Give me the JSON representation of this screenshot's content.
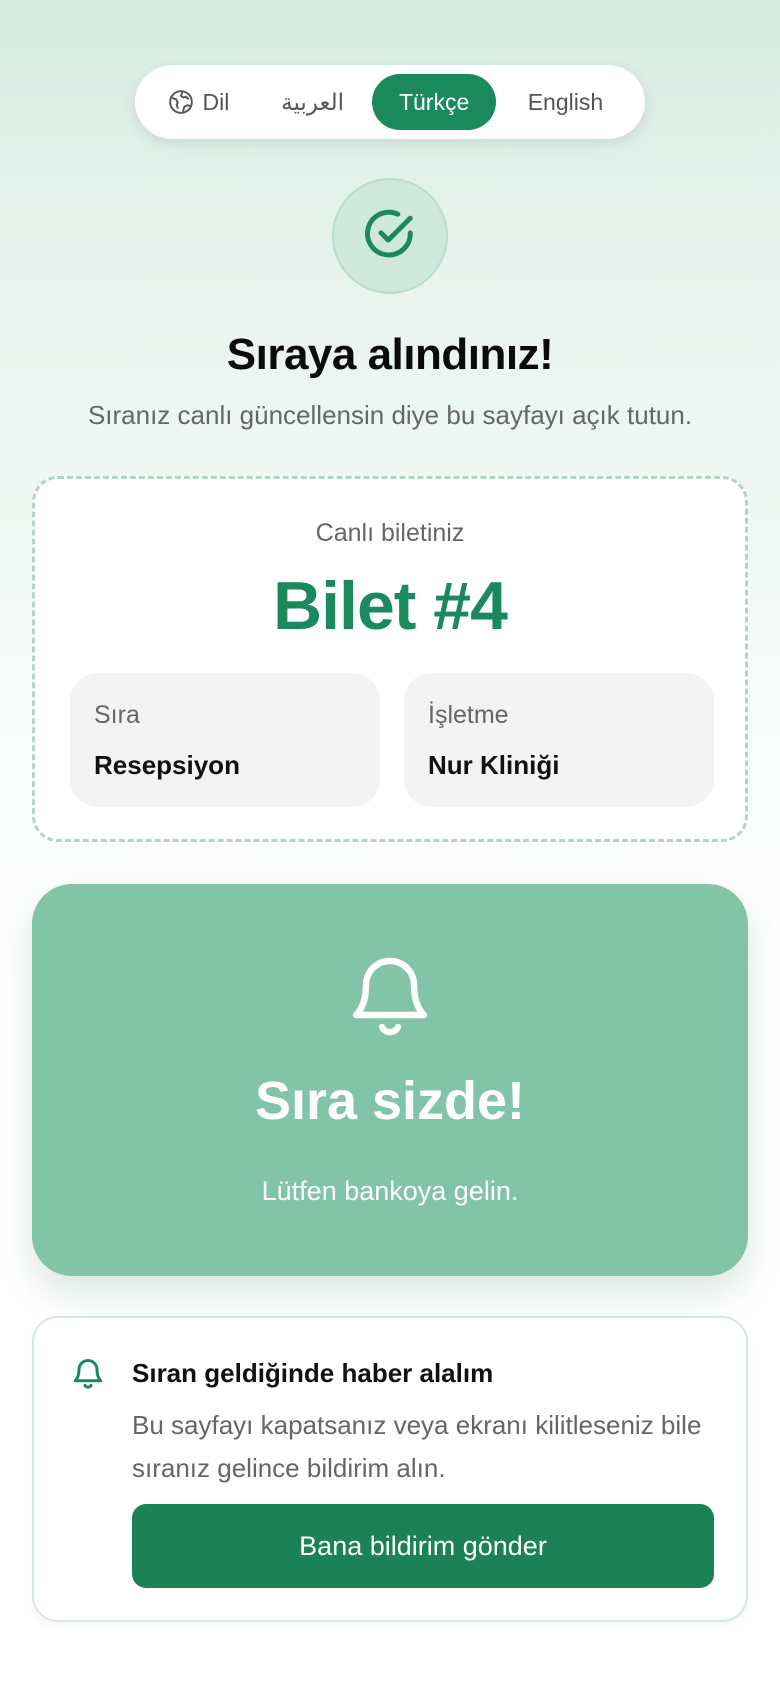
{
  "language_switcher": {
    "label": "Dil",
    "options": [
      "العربية",
      "Türkçe",
      "English"
    ],
    "selected": "Türkçe",
    "icon": "globe-icon"
  },
  "header": {
    "success_icon": "check-circle-icon",
    "title": "Sıraya alındınız!",
    "subtitle": "Sıranız canlı güncellensin diye bu sayfayı açık tutun."
  },
  "ticket": {
    "caption": "Canlı biletiniz",
    "number": "Bilet #4",
    "queue_label": "Sıra",
    "queue_value": "Resepsiyon",
    "business_label": "İşletme",
    "business_value": "Nur Kliniği"
  },
  "turn_panel": {
    "icon": "bell-icon",
    "title": "Sıra sizde!",
    "message": "Lütfen bankoya gelin."
  },
  "notification": {
    "icon": "bell-icon",
    "title": "Sıran geldiğinde haber alalım",
    "description": "Bu sayfayı kapatsanız veya ekranı kilitleseniz bile sıranız gelince bildirim alın.",
    "button_label": "Bana bildirim gönder"
  },
  "colors": {
    "accent": "#1a8a5c",
    "panel": "#82c4a8",
    "button": "#1a8254"
  }
}
